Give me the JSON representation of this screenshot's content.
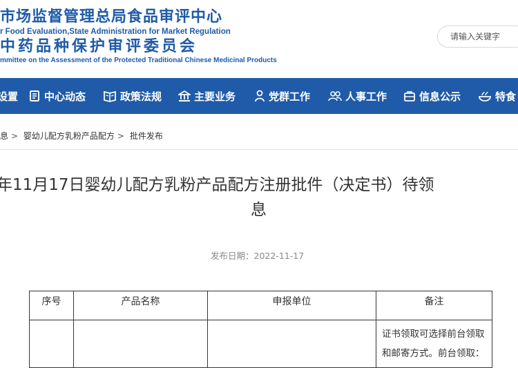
{
  "header": {
    "title_cn": "市场监督管理总局食品审评中心",
    "title_en": "r Food Evaluation,State Administration for Market Regulation",
    "subtitle_cn": "中药品种保护审评委员会",
    "subtitle_en": "mmittee on the Assessment of the Protected Traditional Chinese Medicinal Products",
    "brand_color": "#1f5ba8",
    "search": {
      "placeholder": "请输入关键字"
    }
  },
  "nav": {
    "items": [
      {
        "label": "设置",
        "icon": "settings-icon"
      },
      {
        "label": "中心动态",
        "icon": "document-icon"
      },
      {
        "label": "政策法规",
        "icon": "book-icon"
      },
      {
        "label": "主要业务",
        "icon": "building-icon"
      },
      {
        "label": "党群工作",
        "icon": "person-icon"
      },
      {
        "label": "人事工作",
        "icon": "people-icon"
      },
      {
        "label": "信息公示",
        "icon": "briefcase-icon"
      },
      {
        "label": "特食",
        "icon": "food-icon"
      }
    ]
  },
  "breadcrumb": {
    "items": [
      "息",
      "婴幼儿配方乳粉产品配方",
      "批件发布"
    ],
    "separator": ">"
  },
  "article": {
    "title_line1": "年11月17日婴幼儿配方乳粉产品配方注册批件（决定书）待领",
    "title_line2": "息",
    "publish_date": "发布日期：2022-11-17"
  },
  "table": {
    "headers": [
      "序号",
      "产品名称",
      "申报单位",
      "备注"
    ],
    "row1_note": [
      "证书领取可选择前台领取",
      "和邮寄方式。前台领取："
    ]
  }
}
